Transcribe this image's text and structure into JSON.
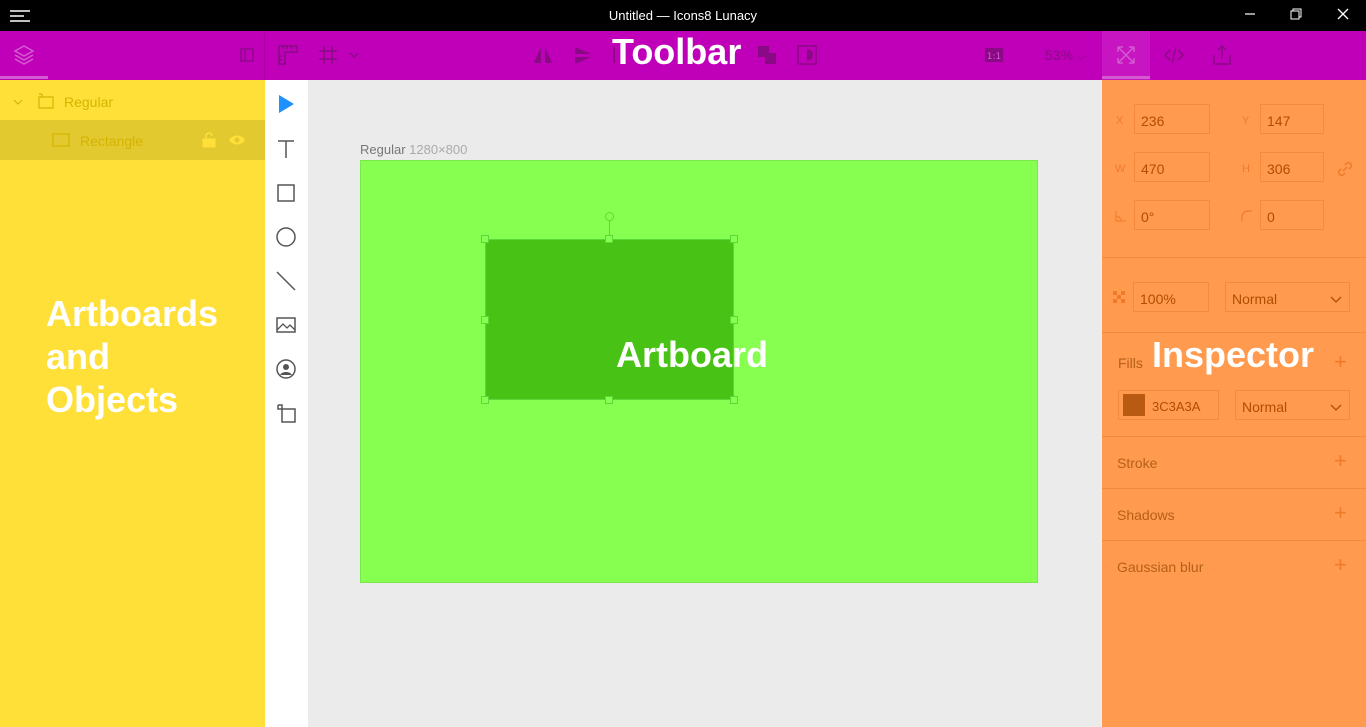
{
  "window": {
    "title": "Untitled — Icons8 Lunacy",
    "menu_icon": "hamburger-icon",
    "controls": [
      "minimize",
      "restore",
      "close"
    ]
  },
  "toolbar": {
    "annotation": "Toolbar",
    "zoom": "53%",
    "zoom_arrow": "chevron-down-icon",
    "icons": [
      "layers-icon",
      "panel-toggle-icon",
      "ruler-icon",
      "grid-icon",
      "flip-horizontal-icon",
      "flip-vertical-icon",
      "align-icon",
      "boolean-icon",
      "mask-icon",
      "pixel-icon",
      "fit-icon",
      "code-icon",
      "export-icon"
    ]
  },
  "layers": {
    "annotation_lines": [
      "Artboards",
      "and",
      "Objects"
    ],
    "items": [
      {
        "label": "Regular",
        "type": "artboard"
      },
      {
        "label": "Rectangle",
        "type": "rectangle"
      }
    ]
  },
  "canvas": {
    "artboard_name": "Regular",
    "artboard_size": "1280×800",
    "annotation": "Artboard"
  },
  "inspector": {
    "annotation": "Inspector",
    "x_label": "X",
    "x_value": "236",
    "y_label": "Y",
    "y_value": "147",
    "w_label": "W",
    "w_value": "470",
    "h_label": "H",
    "h_value": "306",
    "rotation_value": "0°",
    "radius_value": "0",
    "opacity_value": "100%",
    "blend_mode": "Normal",
    "fills_label": "Fills",
    "fill_color_hex": "3C3A3A",
    "fill_swatch": "#b85a12",
    "fill_blend": "Normal",
    "stroke_label": "Stroke",
    "shadows_label": "Shadows",
    "blur_label": "Gaussian blur"
  },
  "colors": {
    "toolbar": "#bf00b8",
    "left_panel": "#ffe039",
    "inspector": "#ff9a4e",
    "artboard": "#86ff50",
    "rectangle": "#48c214",
    "select_tool": "#1e90ff"
  }
}
